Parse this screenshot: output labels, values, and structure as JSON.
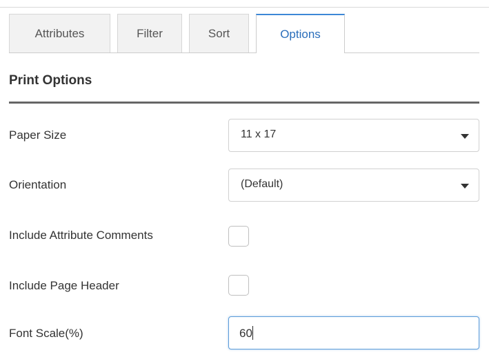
{
  "tabs": [
    {
      "label": "Attributes"
    },
    {
      "label": "Filter"
    },
    {
      "label": "Sort"
    },
    {
      "label": "Options",
      "active": true
    }
  ],
  "section": {
    "title": "Print Options"
  },
  "fields": {
    "paper_size": {
      "label": "Paper Size",
      "value": "11 x 17"
    },
    "orientation": {
      "label": "Orientation",
      "value": "(Default)"
    },
    "include_attribute_comments": {
      "label": "Include Attribute Comments",
      "checked": false
    },
    "include_page_header": {
      "label": "Include Page Header",
      "checked": false
    },
    "font_scale": {
      "label": "Font Scale(%)",
      "value": "60"
    }
  },
  "colors": {
    "accent": "#2a6ebb",
    "active_tab_border": "#3d87d6",
    "focus_border": "#5b9bd9",
    "section_rule": "#666666"
  }
}
